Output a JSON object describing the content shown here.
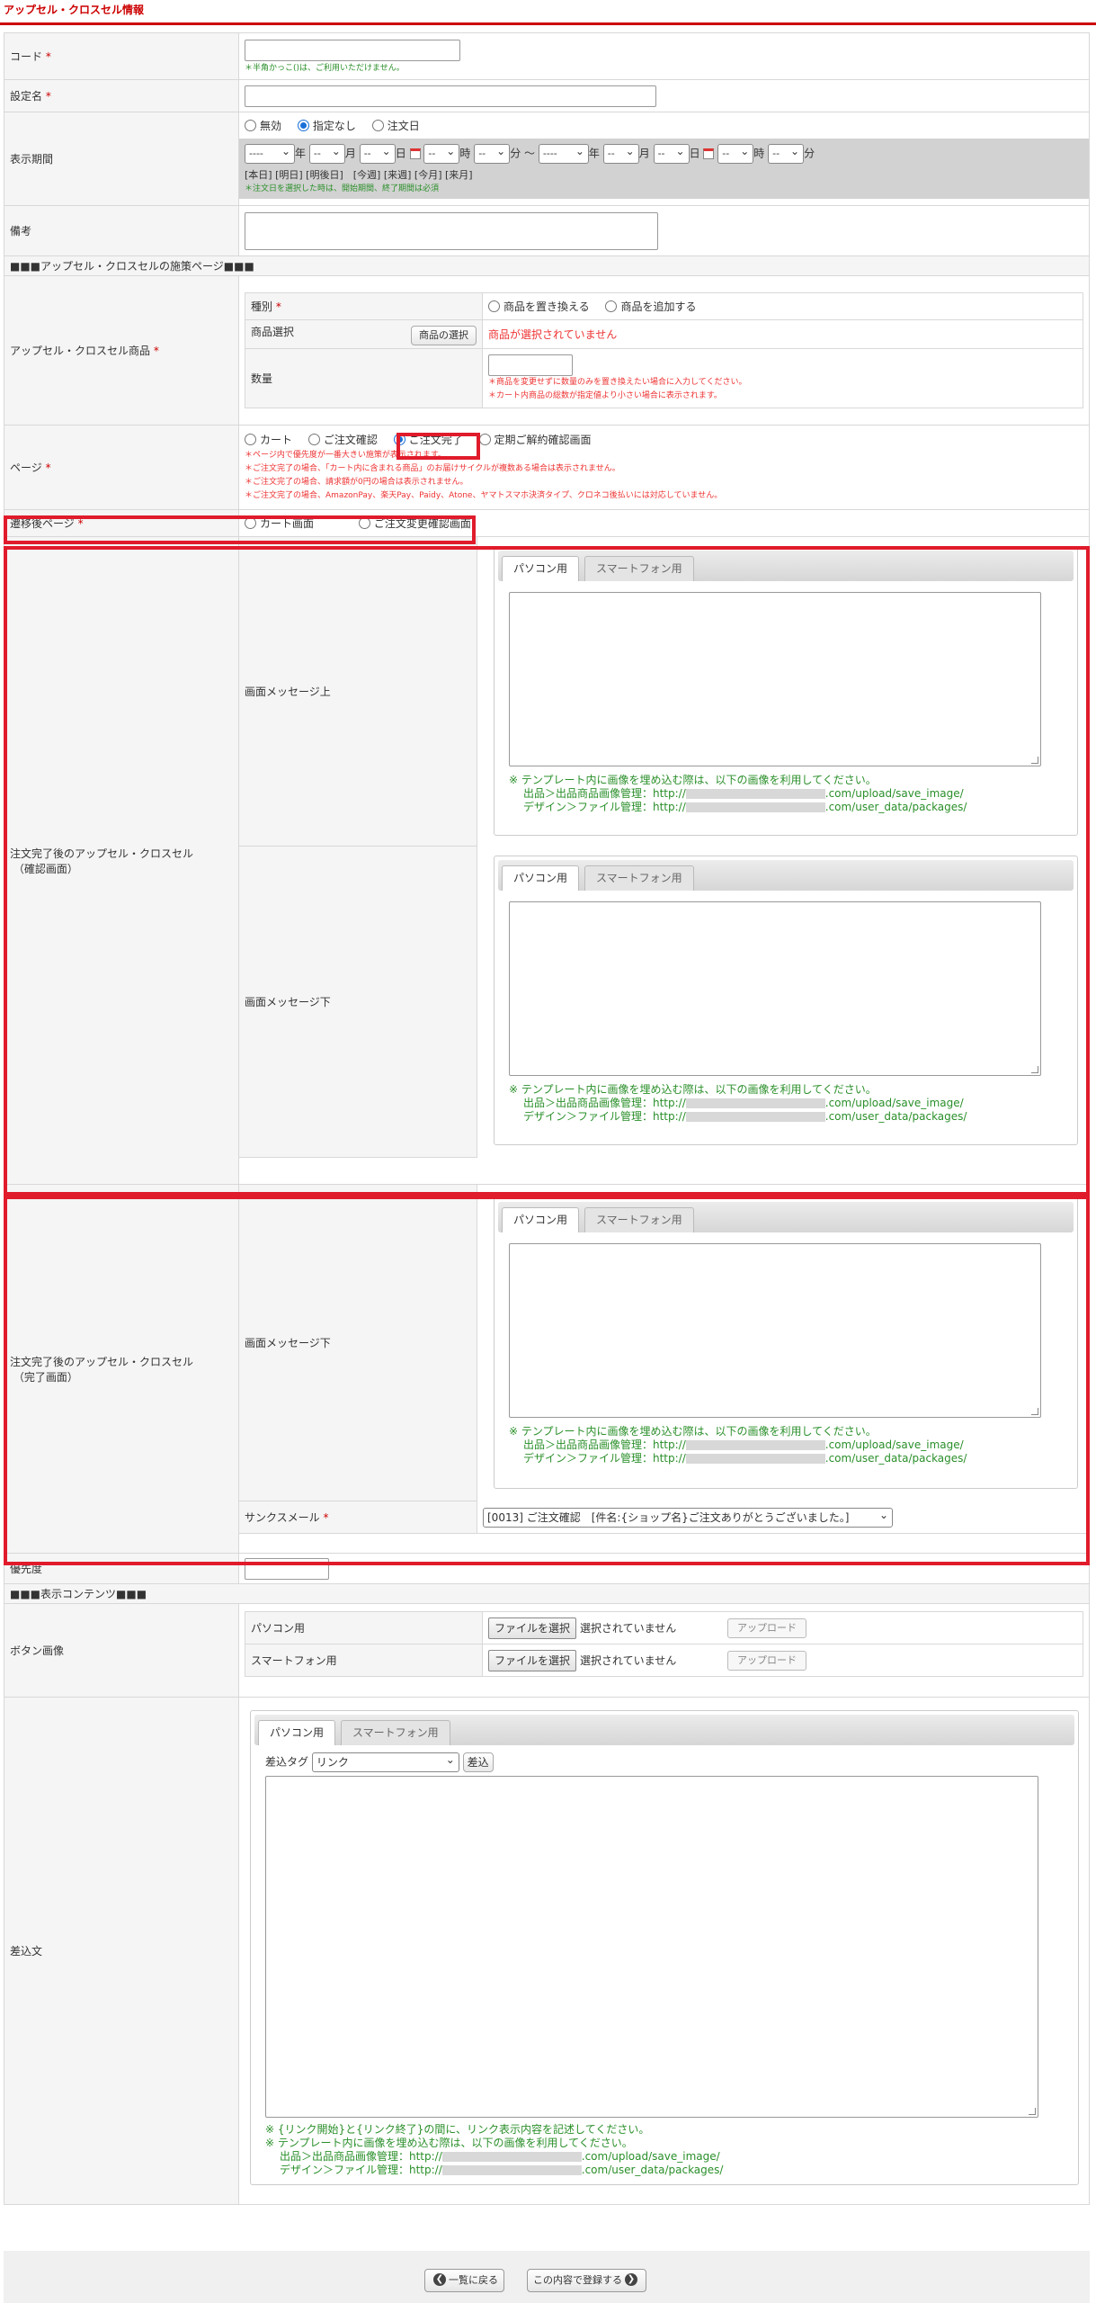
{
  "page_title": "アップセル・クロスセル情報",
  "code": {
    "label": "コード",
    "req": "*",
    "note": "＊半角かっこ()は、ご利用いただけません。"
  },
  "setting_name": {
    "label": "設定名",
    "req": "*"
  },
  "period": {
    "label": "表示期間",
    "radios": [
      "無効",
      "指定なし",
      "注文日"
    ],
    "selected": "指定なし",
    "year_placeholder": "----",
    "sel_placeholder": "--",
    "units": {
      "year": "年",
      "month": "月",
      "day": "日",
      "hour": "時",
      "minute": "分"
    },
    "tilde": "～",
    "quick_links": "[本日] [明日] [明後日]　[今週] [来週] [今月] [来月]",
    "note": "＊注文日を選択した時は、開始期間、終了期間は必須"
  },
  "remarks": {
    "label": "備考"
  },
  "section1": "■■■アップセル・クロスセルの施策ページ■■■",
  "product": {
    "label": "アップセル・クロスセル商品",
    "req": "*",
    "type_label": "種別",
    "type_radios": [
      "商品を置き換える",
      "商品を追加する"
    ],
    "select_label": "商品選択",
    "select_button": "商品の選択",
    "not_selected": "商品が選択されていません",
    "qty_label": "数量",
    "qty_notes": [
      "＊商品を変更せずに数量のみを置き換えたい場合に入力してください。",
      "＊カート内商品の総数が指定値より小さい場合に表示されます。"
    ]
  },
  "page": {
    "label": "ページ",
    "req": "*",
    "radios": [
      "カート",
      "ご注文確認",
      "ご注文完了",
      "定期ご解約確認画面"
    ],
    "selected": "ご注文完了",
    "notes": [
      "＊ページ内で優先度が一番大きい施策が表示されます。",
      "＊ご注文完了の場合、「カート内に含まれる商品」のお届けサイクルが複数ある場合は表示されません。",
      "＊ご注文完了の場合、請求額が0円の場合は表示されません。",
      "＊ご注文完了の場合、AmazonPay、楽天Pay、Paidy、Atone、ヤマトスマホ決済タイプ、クロネコ後払いには対応していません。"
    ]
  },
  "transition": {
    "label": "遷移後ページ",
    "req": "*",
    "radios": [
      "カート画面",
      "ご注文変更確認画面"
    ]
  },
  "confirm_section": {
    "label_line1": "注文完了後のアップセル・クロスセル",
    "label_line2": "（確認画面）",
    "top_label": "画面メッセージ上",
    "bottom_label": "画面メッセージ下"
  },
  "complete_section": {
    "label_line1": "注文完了後のアップセル・クロスセル",
    "label_line2": "（完了画面）",
    "bottom_label": "画面メッセージ下",
    "mail_label": "サンクスメール",
    "mail_req": "*",
    "mail_value": "[0013] ご注文確認　[件名:{ショップ名}ご注文ありがとうございました。]"
  },
  "tabs": {
    "pc": "パソコン用",
    "sp": "スマートフォン用"
  },
  "template_note": {
    "line1": "※ テンプレート内に画像を埋め込む際は、以下の画像を利用してください。",
    "line2_prefix": "出品＞出品商品画像管理：http://",
    "line2_suffix": ".com/upload/save_image/",
    "line3_prefix": "デザイン＞ファイル管理：http://",
    "line3_suffix": ".com/user_data/packages/"
  },
  "priority": {
    "label": "優先度"
  },
  "section2": "■■■表示コンテンツ■■■",
  "button_image": {
    "label": "ボタン画像",
    "pc_label": "パソコン用",
    "sp_label": "スマートフォン用",
    "file_button": "ファイルを選択",
    "no_file": "選択されていません",
    "upload": "アップロード"
  },
  "insert_text": {
    "label": "差込文",
    "tag_label": "差込タグ",
    "tag_value": "リンク",
    "insert_button": "差込",
    "link_note": "※ {リンク開始}と{リンク終了}の間に、リンク表示内容を記述してください。"
  },
  "footer": {
    "back": "一覧に戻る",
    "register": "この内容で登録する"
  },
  "colors": {
    "accent": "#cc0000",
    "highlight": "#e01b2b",
    "note_green": "#2a8f2a"
  }
}
